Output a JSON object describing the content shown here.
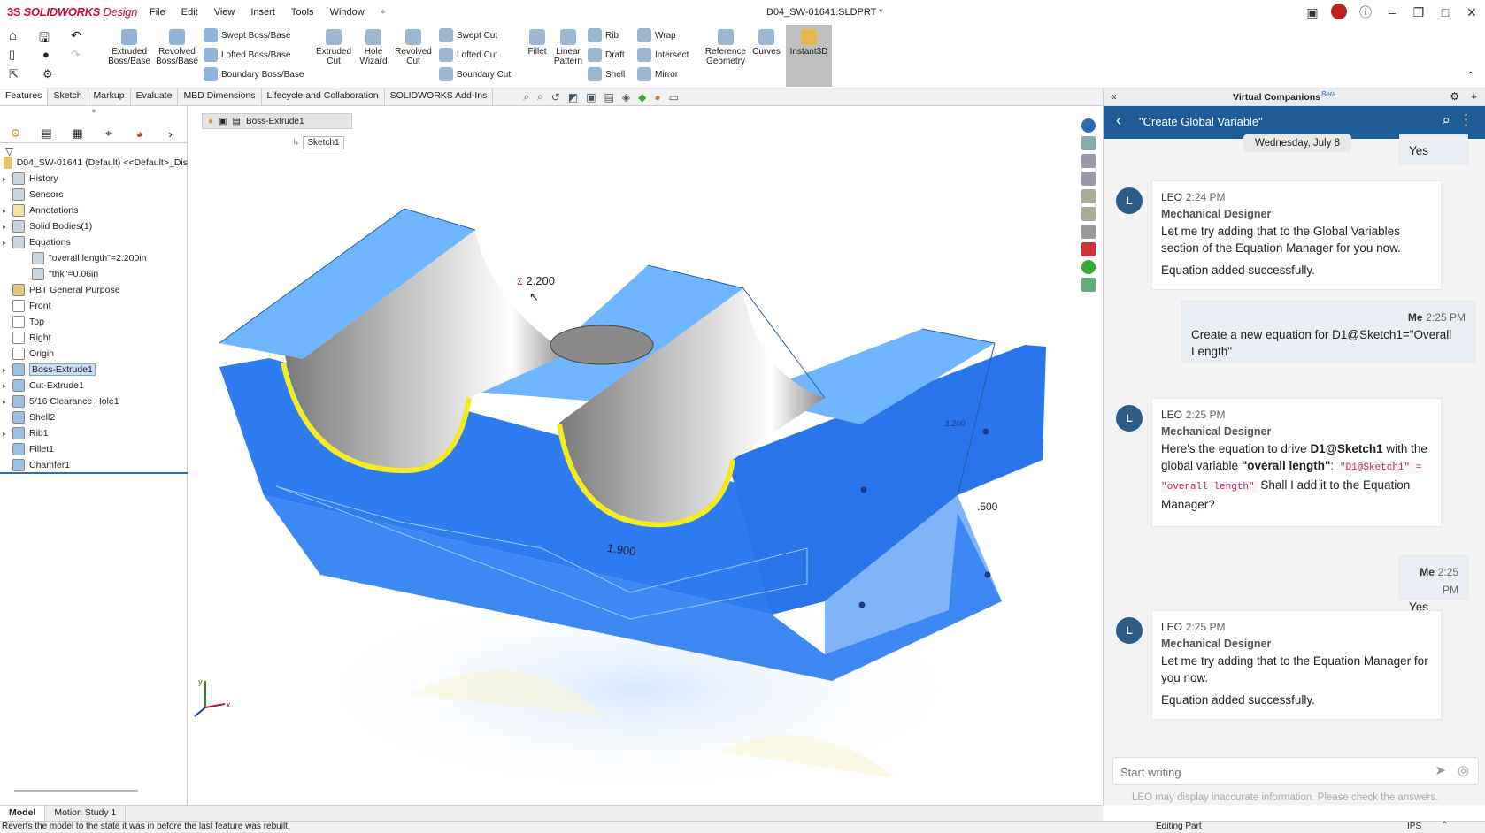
{
  "app": {
    "brand_ds": "3S",
    "brand_name": "SOLIDWORKS",
    "brand_suffix": "Design",
    "doc_title": "D04_SW-01641.SLDPRT *"
  },
  "menu": [
    "File",
    "Edit",
    "View",
    "Insert",
    "Tools",
    "Window"
  ],
  "ribbon": {
    "big": [
      "Extruded Boss/Base",
      "Revolved Boss/Base",
      "Extruded Cut",
      "Hole Wizard",
      "Revolved Cut",
      "Fillet",
      "Linear Pattern",
      "Reference Geometry",
      "Curves",
      "Instant3D"
    ],
    "small": [
      "Swept Boss/Base",
      "Lofted Boss/Base",
      "Boundary Boss/Base",
      "Swept Cut",
      "Lofted Cut",
      "Boundary Cut",
      "Rib",
      "Draft",
      "Shell",
      "Wrap",
      "Intersect",
      "Mirror"
    ]
  },
  "cmd_tabs": [
    "Features",
    "Sketch",
    "Markup",
    "Evaluate",
    "MBD Dimensions",
    "Lifecycle and Collaboration",
    "SOLIDWORKS Add-Ins"
  ],
  "tree": {
    "root": "D04_SW-01641 (Default) <<Default>_Dis",
    "items": [
      "History",
      "Sensors",
      "Annotations",
      "Solid Bodies(1)",
      "Equations",
      "\"overall length\"=2.200in",
      "\"thk\"=0.06in",
      "PBT General Purpose",
      "Front",
      "Top",
      "Right",
      "Origin",
      "Boss-Extrude1",
      "Cut-Extrude1",
      "5/16 Clearance Hole1",
      "Shell2",
      "Rib1",
      "Fillet1",
      "Chamfer1"
    ]
  },
  "viewport": {
    "breadcrumb": "Boss-Extrude1",
    "breadcrumb_child": "Sketch1",
    "dim_length": "2.200",
    "dim_width": "1.900",
    "dim_height": ".500",
    "dim_small": "1.200",
    "triad_x": "x",
    "triad_y": "y"
  },
  "companion": {
    "header": "Virtual Companions",
    "beta": "Beta",
    "chat_title": "\"Create Global Variable\"",
    "date_badge": "Wednesday, July 8",
    "messages": [
      {
        "who": "Me",
        "time": "",
        "text": "Yes"
      },
      {
        "who": "LEO",
        "time": "2:24 PM",
        "role": "Mechanical Designer",
        "text1": "Let me try adding that to the Global Variables section of the Equation Manager for you now.",
        "text2": "Equation added successfully."
      },
      {
        "who": "Me",
        "time": "2:25 PM",
        "text": "Create a new equation for D1@Sketch1=\"Overall Length\""
      },
      {
        "who": "LEO",
        "time": "2:25 PM",
        "role": "Mechanical Designer",
        "t_a": "Here's the equation to drive ",
        "t_b": "D1@Sketch1",
        "t_c": " with the global variable ",
        "t_d": "\"overall length\"",
        "t_e": ":",
        "code": "\"D1@Sketch1\" = \"overall length\"",
        "t_f": " Shall I add it to the Equation Manager?"
      },
      {
        "who": "Me",
        "time": "2:25 PM",
        "text": "Yes"
      },
      {
        "who": "LEO",
        "time": "2:25 PM",
        "role": "Mechanical Designer",
        "text1": "Let me try adding that to the Equation Manager for you now.",
        "text2": "Equation added successfully."
      }
    ],
    "input_placeholder": "Start writing",
    "disclaimer": "LEO may display inaccurate information. Please check the answers."
  },
  "bottom_tabs": [
    "Model",
    "Motion Study 1"
  ],
  "status": {
    "left": "Reverts the model to the state it was in before the last feature was rebuilt.",
    "mode": "Editing Part",
    "units": "IPS"
  }
}
